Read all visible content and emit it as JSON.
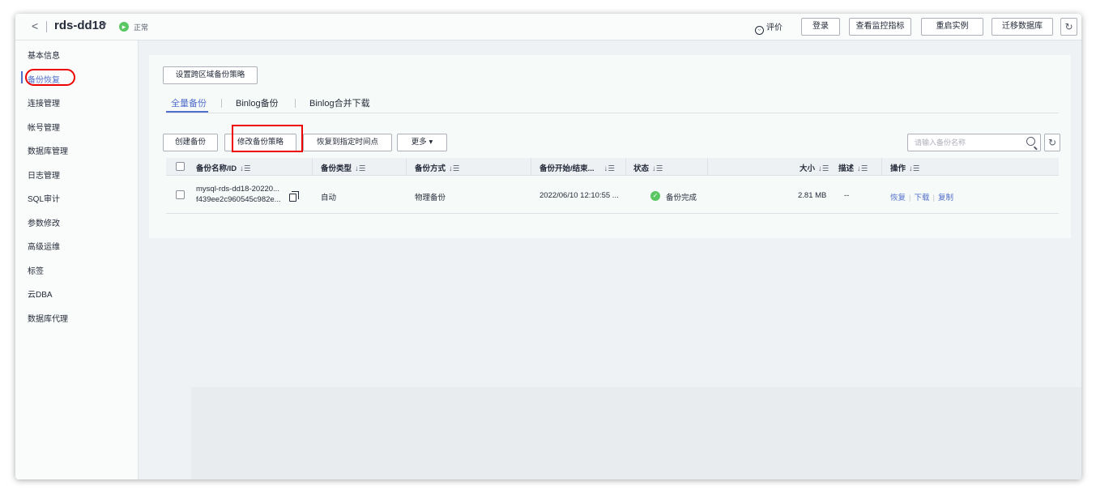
{
  "header": {
    "back_icon": "chevron-left-icon",
    "instance_name": "rds-dd18",
    "instance_caret": "▾",
    "status": "正常",
    "rate_label": "评价",
    "buttons": [
      "登录",
      "查看监控指标",
      "重启实例",
      "迁移数据库"
    ],
    "refresh_icon": "refresh-icon"
  },
  "sidebar": {
    "items": [
      {
        "label": "基本信息"
      },
      {
        "label": "备份恢复",
        "active": true
      },
      {
        "label": "连接管理"
      },
      {
        "label": "帐号管理"
      },
      {
        "label": "数据库管理"
      },
      {
        "label": "日志管理"
      },
      {
        "label": "SQL审计"
      },
      {
        "label": "参数修改"
      },
      {
        "label": "高级运维"
      },
      {
        "label": "标签"
      },
      {
        "label": "云DBA"
      },
      {
        "label": "数据库代理"
      }
    ]
  },
  "main": {
    "cross_region_button": "设置跨区域备份策略",
    "tabs": [
      {
        "label": "全量备份",
        "active": true
      },
      {
        "label": "Binlog备份"
      },
      {
        "label": "Binlog合并下载"
      }
    ],
    "toolbar": {
      "create_backup": "创建备份",
      "modify_policy": "修改备份策略",
      "restore_to_point": "恢复到指定时间点",
      "more": "更多",
      "more_caret": "▾"
    },
    "search": {
      "placeholder": "请输入备份名称"
    },
    "table": {
      "columns": [
        "备份名称/ID",
        "备份类型",
        "备份方式",
        "备份开始/结束...",
        "状态",
        "大小",
        "描述",
        "操作"
      ],
      "sort_icon": "↓☰",
      "rows": [
        {
          "name": "mysql-rds-dd18-20220...",
          "id": "f439ee2c960545c982e...",
          "type": "自动",
          "method": "物理备份",
          "time": "2022/06/10 12:10:55 ...",
          "status": "备份完成",
          "size": "2.81 MB",
          "desc": "--",
          "ops": [
            "恢复",
            "下载",
            "复制"
          ]
        }
      ]
    }
  },
  "colors": {
    "accent": "#526ecc",
    "success": "#5ac763",
    "highlight": "#ee0000"
  }
}
